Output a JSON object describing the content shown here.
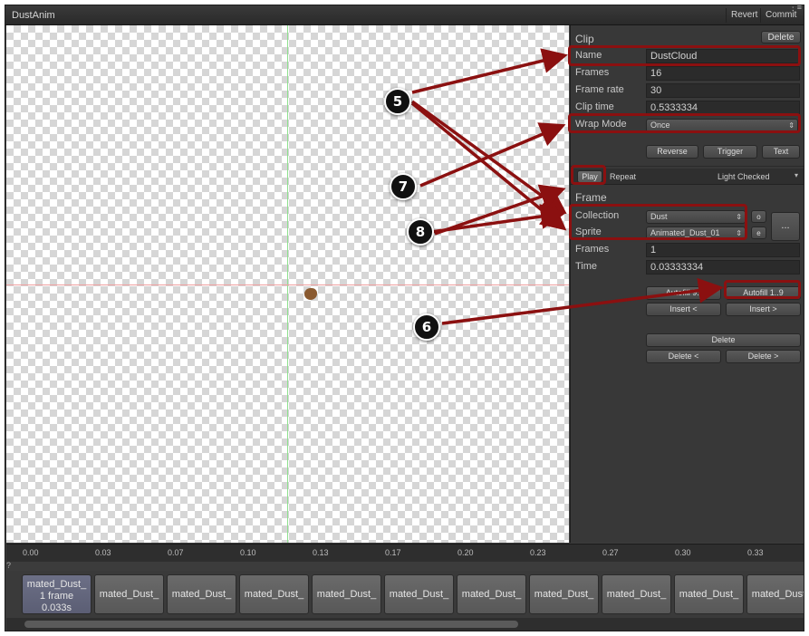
{
  "window": {
    "title": "DustAnim",
    "revert_label": "Revert",
    "commit_label": "Commit",
    "menu_glyph": "⋮≡"
  },
  "clip": {
    "header": "Clip",
    "delete_label": "Delete",
    "name_label": "Name",
    "name_value": "DustCloud",
    "frames_label": "Frames",
    "frames_value": "16",
    "frame_rate_label": "Frame rate",
    "frame_rate_value": "30",
    "clip_time_label": "Clip time",
    "clip_time_value": "0.5333334",
    "wrap_mode_label": "Wrap Mode",
    "wrap_mode_value": "Once",
    "reverse_label": "Reverse",
    "trigger_label": "Trigger",
    "text_label": "Text"
  },
  "playbar": {
    "play_label": "Play",
    "repeat_label": "Repeat",
    "background_value": "Light Checked"
  },
  "frame": {
    "header": "Frame",
    "collection_label": "Collection",
    "collection_value": "Dust",
    "collection_btn": "o",
    "sprite_label": "Sprite",
    "sprite_value": "Animated_Dust_01",
    "sprite_btn": "e",
    "more_btn": "...",
    "frames_label": "Frames",
    "frames_value": "1",
    "time_label": "Time",
    "time_value": "0.03333334",
    "autofill_left": "Autofill 9..",
    "autofill_right": "Autofill 1..9",
    "insert_left": "Insert <",
    "insert_right": "Insert >",
    "delete_label": "Delete",
    "delete_left": "Delete <",
    "delete_right": "Delete >"
  },
  "timeline": {
    "ticks": [
      "0.00",
      "0.03",
      "0.07",
      "0.10",
      "0.13",
      "0.17",
      "0.20",
      "0.23",
      "0.27",
      "0.30",
      "0.33"
    ],
    "help_glyph": "?",
    "first_frame": {
      "name": "mated_Dust_",
      "count": "1 frame",
      "time": "0.033s"
    },
    "frame_names": [
      "mated_Dust_",
      "mated_Dust_",
      "mated_Dust_",
      "mated_Dust_",
      "mated_Dust_",
      "mated_Dust_",
      "mated_Dust_",
      "mated_Dust_",
      "mated_Dust_",
      "mated_Dust_"
    ]
  },
  "callouts": [
    "5",
    "6",
    "7",
    "8"
  ],
  "colors": {
    "annotation": "#8b1010",
    "panel_bg": "#383838",
    "selected_frame": "#6c6f86"
  }
}
